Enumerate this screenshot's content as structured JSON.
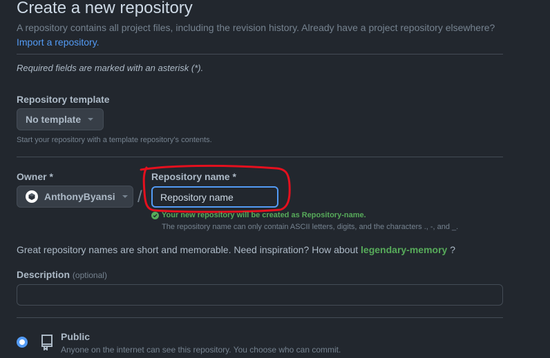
{
  "header": {
    "title": "Create a new repository",
    "subtitle": "A repository contains all project files, including the revision history. Already have a project repository elsewhere?",
    "import_link": "Import a repository."
  },
  "required_note": "Required fields are marked with an asterisk (*).",
  "template": {
    "label": "Repository template",
    "selected": "No template",
    "hint": "Start your repository with a template repository's contents."
  },
  "owner": {
    "label": "Owner *",
    "selected": "AnthonyByansi"
  },
  "separator": "/",
  "repo_name": {
    "label": "Repository name *",
    "value": "Repository name",
    "success": "Your new repository will be created as Repository-name.",
    "hint": "The repository name can only contain ASCII letters, digits, and the characters ., -, and _."
  },
  "inspiration": {
    "text": "Great repository names are short and memorable. Need inspiration? How about",
    "suggestion": "legendary-memory",
    "suffix": "?"
  },
  "description": {
    "label": "Description",
    "optional": "(optional)",
    "value": ""
  },
  "visibility": {
    "public_label": "Public",
    "public_hint": "Anyone on the internet can see this repository. You choose who can commit.",
    "public_selected": true
  },
  "colors": {
    "background": "#22272e",
    "accent_blue": "#539bf5",
    "success_green": "#57ab5a",
    "annotation_red": "#e5101e"
  },
  "icons": {
    "avatar": "owner-avatar-icon",
    "caret": "chevron-down-icon",
    "check": "check-circle-icon",
    "repo": "repo-icon"
  }
}
